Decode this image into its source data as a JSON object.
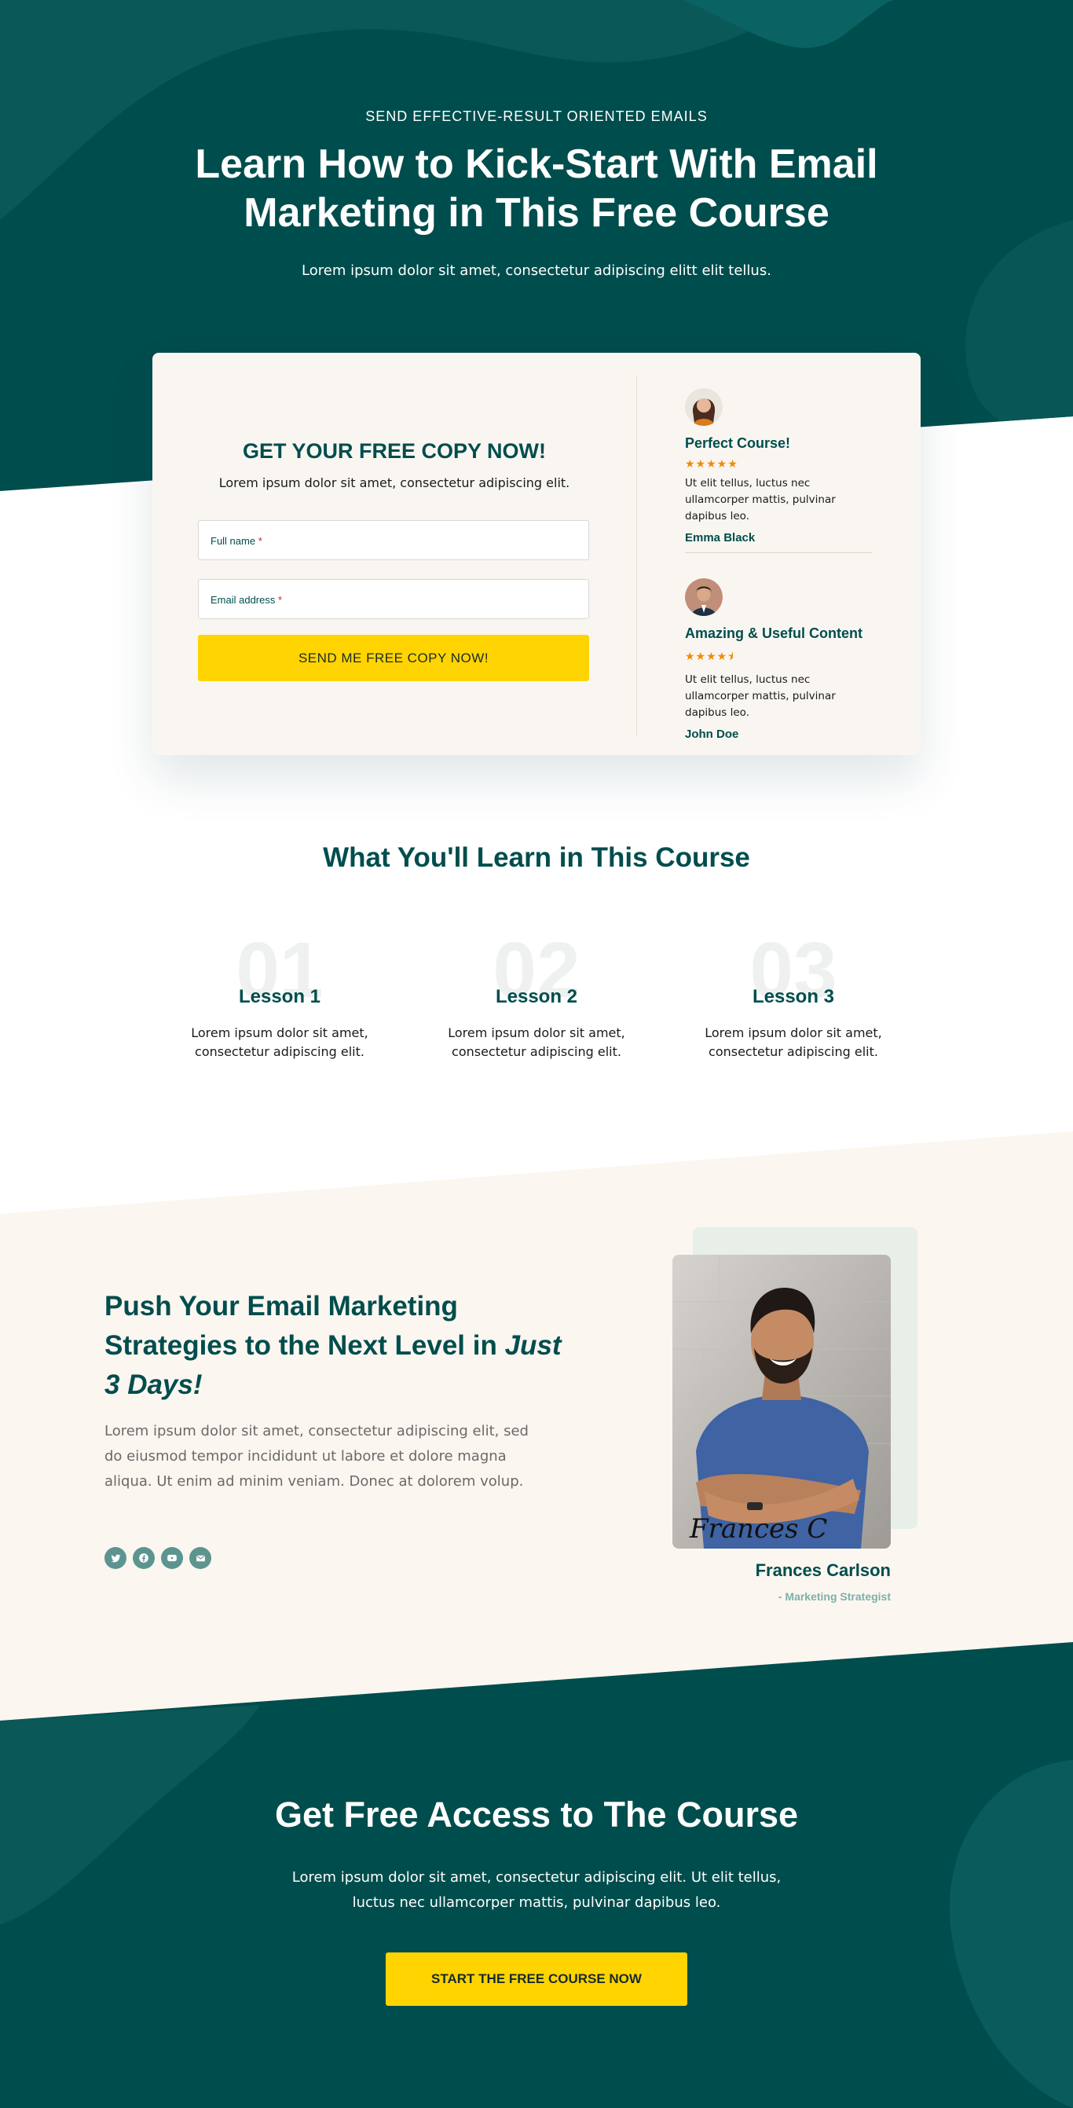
{
  "hero": {
    "eyebrow": "SEND EFFECTIVE-RESULT ORIENTED EMAILS",
    "title": "Learn How to Kick-Start With Email Marketing in This Free Course",
    "subtitle": "Lorem ipsum dolor sit amet, consectetur adipiscing elitt elit tellus."
  },
  "optin": {
    "title": "GET YOUR FREE COPY NOW!",
    "description": "Lorem ipsum dolor sit amet, consectetur adipiscing elit.",
    "fields": {
      "name_label": "Full name",
      "email_label": "Email address",
      "required_mark": "*"
    },
    "submit_label": "SEND ME FREE COPY NOW!"
  },
  "reviews": [
    {
      "title": "Perfect Course!",
      "rating": 5,
      "stars": "★★★★★",
      "text": "Ut elit tellus, luctus nec ullamcorper mattis, pulvinar dapibus leo.",
      "author": "Emma Black"
    },
    {
      "title": "Amazing & Useful Content",
      "rating": 4.5,
      "stars": "★★★★⯨",
      "text": "Ut elit tellus, luctus nec ullamcorper mattis, pulvinar dapibus leo.",
      "author": "John Doe"
    }
  ],
  "learn": {
    "title": "What You'll Learn in This Course",
    "lessons": [
      {
        "number": "01",
        "title": "Lesson 1",
        "text": "Lorem ipsum dolor sit amet, consectetur adipiscing elit."
      },
      {
        "number": "02",
        "title": "Lesson 2",
        "text": "Lorem ipsum dolor sit amet, consectetur adipiscing elit."
      },
      {
        "number": "03",
        "title": "Lesson 3",
        "text": "Lorem ipsum dolor sit amet, consectetur adipiscing elit."
      }
    ]
  },
  "push": {
    "title_main": "Push Your Email Marketing Strategies to the Next Level in ",
    "title_emphasis": "Just 3 Days!",
    "body": "Lorem ipsum dolor sit amet, consectetur adipiscing elit, sed do eiusmod tempor incididunt ut labore et dolore magna aliqua. Ut enim ad minim veniam. Donec at dolorem volup.",
    "socials": [
      "twitter-icon",
      "facebook-icon",
      "youtube-icon",
      "envelope-icon"
    ],
    "person_name": "Frances Carlson",
    "person_role": "- Marketing Strategist",
    "signature": "Frances C"
  },
  "cta": {
    "title": "Get Free Access to The Course",
    "text": "Lorem ipsum dolor sit amet, consectetur adipiscing elit. Ut elit tellus, luctus nec ullamcorper mattis, pulvinar dapibus leo.",
    "button_label": "START THE FREE COURSE NOW"
  },
  "colors": {
    "primary": "#004d4d",
    "accent": "#ffd400",
    "star": "#f08a00",
    "cream": "#f9f6f1",
    "muted_teal": "#5d9490"
  }
}
